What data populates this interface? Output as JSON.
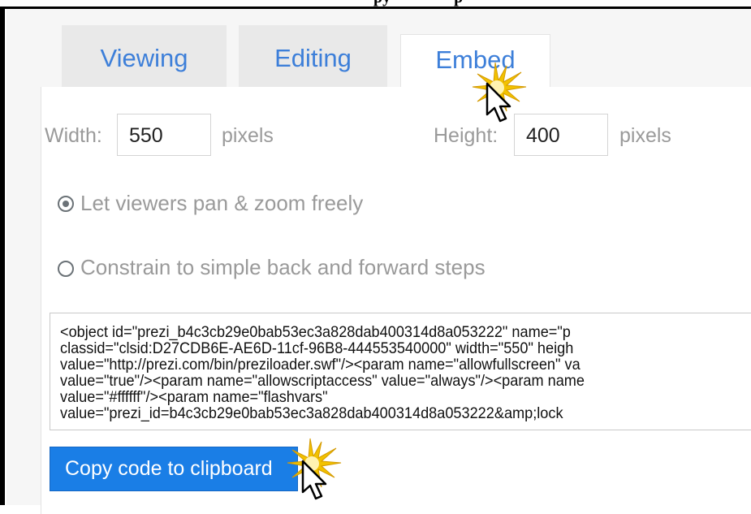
{
  "header_fragment": {
    "left": "py",
    "right": "p"
  },
  "tabs": [
    {
      "label": "Viewing",
      "active": false
    },
    {
      "label": "Editing",
      "active": false
    },
    {
      "label": "Embed",
      "active": true
    }
  ],
  "width": {
    "label": "Width:",
    "value": "550",
    "unit": "pixels"
  },
  "height": {
    "label": "Height:",
    "value": "400",
    "unit": "pixels"
  },
  "options": [
    {
      "label": "Let viewers pan & zoom freely",
      "selected": true
    },
    {
      "label": "Constrain to simple back and forward steps",
      "selected": false
    }
  ],
  "embed_code_lines": [
    "<object id=\"prezi_b4c3cb29e0bab53ec3a828dab400314d8a053222\" name=\"p",
    "classid=\"clsid:D27CDB6E-AE6D-11cf-96B8-444553540000\" width=\"550\" heigh",
    "value=\"http://prezi.com/bin/preziloader.swf\"/><param name=\"allowfullscreen\" va",
    "value=\"true\"/><param name=\"allowscriptaccess\" value=\"always\"/><param name",
    "value=\"#ffffff\"/><param name=\"flashvars\"",
    "value=\"prezi_id=b4c3cb29e0bab53ec3a828dab400314d8a053222&amp;lock"
  ],
  "copy_button": {
    "label": "Copy code to clipboard"
  },
  "colors": {
    "accent": "#3d7fd9",
    "button": "#1a7ee6",
    "sparkle": "#f2c200"
  }
}
